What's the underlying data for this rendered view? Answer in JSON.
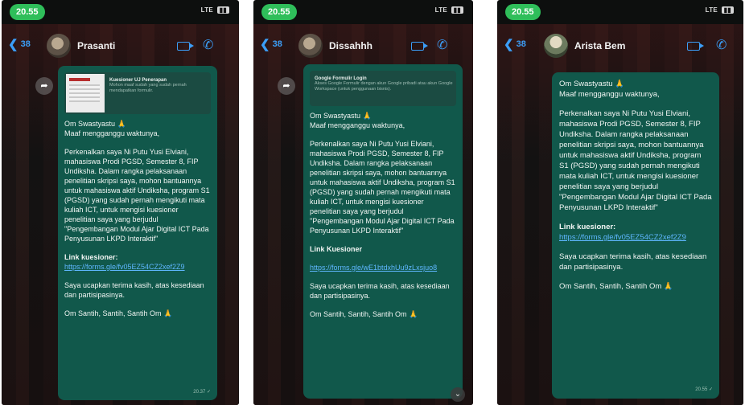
{
  "colors": {
    "bubble": "#11584b",
    "accent": "#3b9ef7",
    "link": "#5fb7ff",
    "time_pill": "#2fbe5a"
  },
  "icons": [
    "back-chevron-icon",
    "video-call-icon",
    "phone-call-icon",
    "forward-icon",
    "scroll-down-icon"
  ],
  "screens": [
    {
      "time": "20.55",
      "network": "LTE",
      "back_count": "38",
      "contact": "Prasanti",
      "preview_title": "Kuesioner UJ Penerapan",
      "preview_desc": "Mohon maaf sudah yang sudah pernah mendapatkan formulir.",
      "greeting": "Om Swastyastu 🙏",
      "apology": "Maaf mengganggu waktunya,",
      "body": "Perkenalkan saya Ni Putu Yusi Elviani, mahasiswa Prodi PGSD, Semester 8, FIP Undiksha. Dalam rangka pelaksanaan penelitian skripsi saya, mohon bantuannya untuk mahasiswa aktif Undiksha, program S1 (PGSD) yang sudah pernah mengikuti mata kuliah ICT, untuk mengisi kuesioner penelitian saya yang berjudul \"Pengembangan Modul Ajar Digital ICT Pada Penyusunan LKPD Interaktif\"",
      "link_label": "Link kuesioner:",
      "link": "https://forms.gle/fv05EZ54CZ2xef2Z9",
      "thanks": "Saya ucapkan terima kasih, atas kesediaan dan partisipasinya.",
      "closing": "Om Santih, Santih, Santih Om 🙏",
      "timestamp": "20.37 ✓"
    },
    {
      "time": "20.55",
      "network": "LTE",
      "back_count": "38",
      "contact": "Dissahhh",
      "preview_title": "Google Formulir Login",
      "preview_desc": "Akses Google Formulir dengan akun Google pribadi atau akun Google Workspace (untuk penggunaan bisnis).",
      "greeting": "Om Swastyastu 🙏",
      "apology": "Maaf mengganggu waktunya,",
      "body": "Perkenalkan saya Ni Putu Yusi Elviani, mahasiswa Prodi PGSD, Semester 8, FIP Undiksha. Dalam rangka pelaksanaan penelitian skripsi saya, mohon bantuannya untuk mahasiswa aktif Undiksha, program S1 (PGSD) yang sudah pernah mengikuti mata kuliah ICT, untuk mengisi kuesioner penelitian saya yang berjudul \"Pengembangan Modul Ajar Digital ICT Pada Penyusunan LKPD Interaktif\"",
      "link_label": "Link Kuesioner",
      "link": "https://forms.gle/wE1btdxhUu9zLxsjuo8",
      "thanks": "Saya ucapkan terima kasih, atas kesediaan dan partisipasinya.",
      "closing": "Om Santih, Santih, Santih Om 🙏"
    },
    {
      "time": "20.55",
      "network": "LTE",
      "back_count": "38",
      "contact": "Arista Bem",
      "greeting": "Om Swastyastu 🙏",
      "apology": "Maaf mengganggu waktunya,",
      "body": "Perkenalkan saya Ni Putu Yusi Elviani, mahasiswa Prodi PGSD, Semester 8, FIP Undiksha. Dalam rangka pelaksanaan penelitian skripsi saya, mohon bantuannya untuk mahasiswa aktif Undiksha, program S1 (PGSD) yang sudah pernah mengikuti mata kuliah ICT, untuk mengisi kuesioner penelitian saya yang berjudul \"Pengembangan Modul Ajar Digital ICT Pada Penyusunan LKPD Interaktif\"",
      "link_label": "Link kuesioner:",
      "link": "https://forms.gle/fv05EZ54CZ2xef2Z9",
      "thanks": "Saya ucapkan terima kasih, atas kesediaan dan partisipasinya.",
      "closing": "Om Santih, Santih, Santih Om 🙏",
      "timestamp": "20.55 ✓"
    }
  ]
}
